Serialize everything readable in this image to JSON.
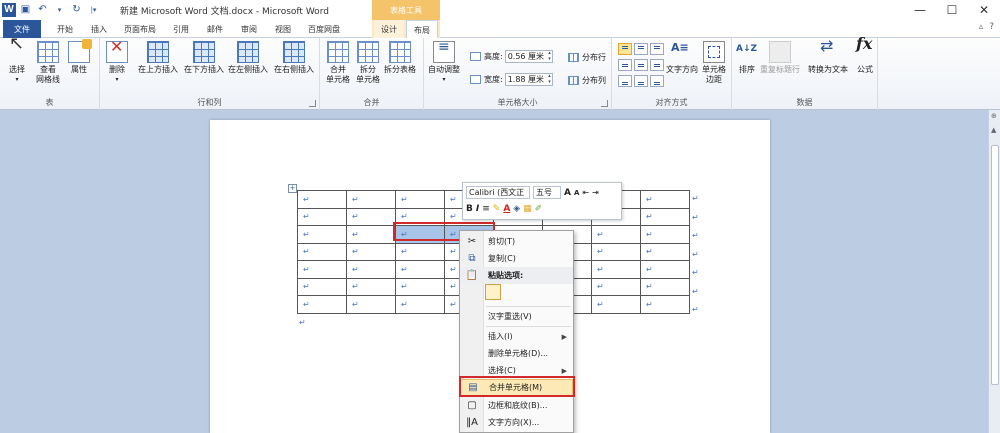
{
  "titlebar": {
    "title": "新建 Microsoft Word 文档.docx  -  Microsoft Word",
    "context_tab_header": "表格工具",
    "minimize": "—",
    "maximize": "☐",
    "close": "✕"
  },
  "tabs": [
    {
      "label": "文件"
    },
    {
      "label": "开始"
    },
    {
      "label": "插入"
    },
    {
      "label": "页面布局"
    },
    {
      "label": "引用"
    },
    {
      "label": "邮件"
    },
    {
      "label": "审阅"
    },
    {
      "label": "视图"
    },
    {
      "label": "百度网盘"
    },
    {
      "label": "设计"
    },
    {
      "label": "布局"
    }
  ],
  "ribbon": {
    "groups": {
      "table": "表",
      "rows_cols": "行和列",
      "merge": "合并",
      "cell_size": "单元格大小",
      "alignment": "对齐方式",
      "data": "数据"
    },
    "buttons": {
      "select": "选择",
      "view_gridlines": "查看\n网格线",
      "properties": "属性",
      "delete": "删除",
      "insert_above": "在上方插入",
      "insert_below": "在下方插入",
      "insert_left": "在左侧插入",
      "insert_right": "在右侧插入",
      "merge_cells": "合并\n单元格",
      "split_cells": "拆分\n单元格",
      "split_table": "拆分表格",
      "autofit": "自动调整",
      "height_label": "高度:",
      "height_value": "0.56 厘米",
      "width_label": "宽度:",
      "width_value": "1.88 厘米",
      "distribute_rows": "分布行",
      "distribute_cols": "分布列",
      "text_direction": "文字方向",
      "cell_margins": "单元格\n边距",
      "sort": "排序",
      "repeat_header": "重复标题行",
      "convert_to_text": "转换为文本",
      "formula": "公式"
    }
  },
  "mini_toolbar": {
    "font": "Calibri (西文正",
    "size": "五号",
    "grow": "A",
    "shrink": "A",
    "bold": "B",
    "italic": "I"
  },
  "context_menu": {
    "items": [
      {
        "label": "剪切(T)"
      },
      {
        "label": "复制(C)"
      },
      {
        "label": "粘贴选项:"
      },
      {
        "label": "汉字重选(V)"
      },
      {
        "label": "插入(I)"
      },
      {
        "label": "删除单元格(D)..."
      },
      {
        "label": "选择(C)"
      },
      {
        "label": "合并单元格(M)"
      },
      {
        "label": "边框和底纹(B)..."
      },
      {
        "label": "文字方向(X)..."
      }
    ]
  },
  "document": {
    "cell_mark": "↵",
    "rows": 7,
    "cols": 8
  },
  "colors": {
    "accent": "#2b579a",
    "context_tab": "#f4c36a",
    "selection": "#a8c4e8",
    "highlight_box": "#d02a2a",
    "workspace": "#bccde3"
  }
}
